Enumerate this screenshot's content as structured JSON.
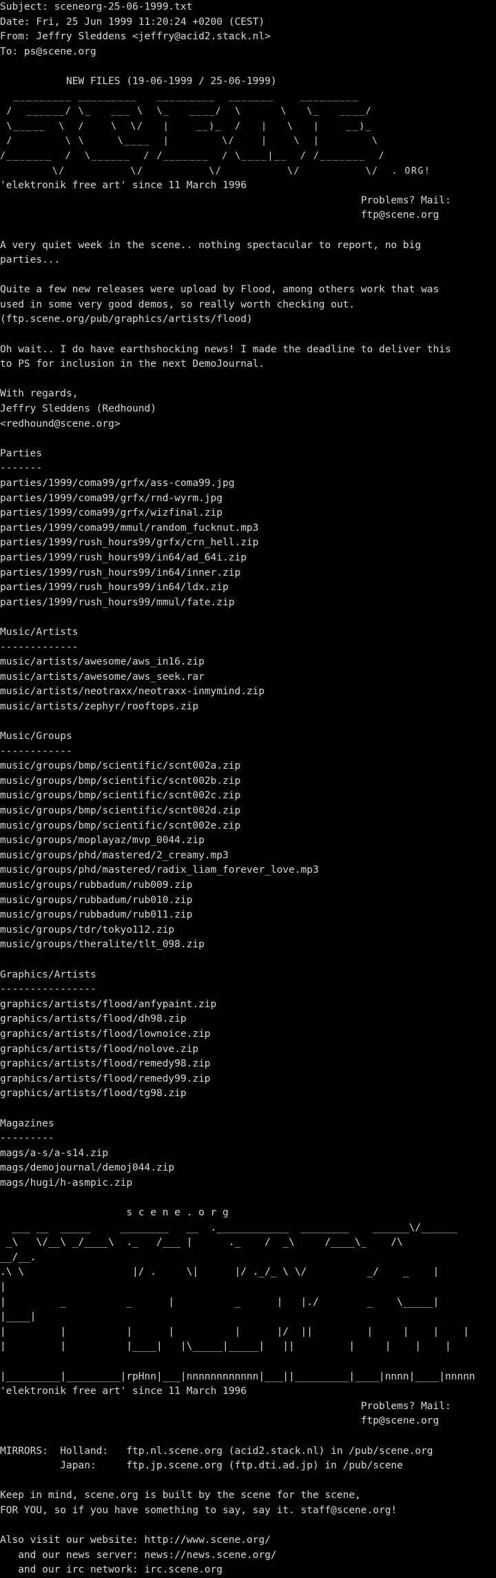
{
  "header": {
    "subject": "Subject: sceneorg-25-06-1999.txt",
    "date": "Date: Fri, 25 Jun 1999 11:20:24 +0200 (CEST)",
    "from": "From: Jeffry Sleddens <jeffry@acid2.stack.nl>",
    "to": "To: ps@scene.org"
  },
  "title": "           NEW FILES (19-06-1999 / 25-06-1999)",
  "logo1": [
    "  _________ _________   _________  _______    _________",
    " /  ______/ \\_   ___ \\  \\_   ____/  \\      \\   \\_   ____/",
    " \\_____  \\  /    \\  \\/   |    __)_  /   |   \\   |    __)_",
    " /        \\ \\     \\____  |        \\/    |    \\  |        \\",
    "/_______  /  \\______  / /_______  / \\____|__  / /_______  /",
    "        \\/          \\/          \\/          \\/          \\/  . ORG!"
  ],
  "tagline": "'elektronik free art' since 11 March 1996",
  "problems": {
    "label": "                                                            Problems? Mail:",
    "email": "                                                            ftp@scene.org"
  },
  "intro": [
    "A very quiet week in the scene.. nothing spectacular to report, no big",
    "parties...",
    "",
    "Quite a few new releases were upload by Flood, among others work that was",
    "used in some very good demos, so really worth checking out.",
    "(ftp.scene.org/pub/graphics/artists/flood)",
    "",
    "Oh wait.. I do have earthshocking news! I made the deadline to deliver this",
    "to PS for inclusion in the next DemoJournal.",
    "",
    "With regards,",
    "Jeffry Sleddens (Redhound)",
    "<redhound@scene.org>"
  ],
  "sections": [
    {
      "title": "Parties",
      "underline": "-------",
      "files": [
        "parties/1999/coma99/grfx/ass-coma99.jpg",
        "parties/1999/coma99/grfx/rnd-wyrm.jpg",
        "parties/1999/coma99/grfx/wizfinal.zip",
        "parties/1999/coma99/mmul/random_fucknut.mp3",
        "parties/1999/rush_hours99/grfx/crn_hell.zip",
        "parties/1999/rush_hours99/in64/ad_64i.zip",
        "parties/1999/rush_hours99/in64/inner.zip",
        "parties/1999/rush_hours99/in64/ldx.zip",
        "parties/1999/rush_hours99/mmul/fate.zip"
      ]
    },
    {
      "title": "Music/Artists",
      "underline": "-------------",
      "files": [
        "music/artists/awesome/aws_in16.zip",
        "music/artists/awesome/aws_seek.rar",
        "music/artists/neotraxx/neotraxx-inmymind.zip",
        "music/artists/zephyr/rooftops.zip"
      ]
    },
    {
      "title": "Music/Groups",
      "underline": "------------",
      "files": [
        "music/groups/bmp/scientific/scnt002a.zip",
        "music/groups/bmp/scientific/scnt002b.zip",
        "music/groups/bmp/scientific/scnt002c.zip",
        "music/groups/bmp/scientific/scnt002d.zip",
        "music/groups/bmp/scientific/scnt002e.zip",
        "music/groups/moplayaz/mvp_0044.zip",
        "music/groups/phd/mastered/2_creamy.mp3",
        "music/groups/phd/mastered/radix_liam_forever_love.mp3",
        "music/groups/rubbadum/rub009.zip",
        "music/groups/rubbadum/rub010.zip",
        "music/groups/rubbadum/rub011.zip",
        "music/groups/tdr/tokyo112.zip",
        "music/groups/theralite/tlt_098.zip"
      ]
    },
    {
      "title": "Graphics/Artists",
      "underline": "----------------",
      "files": [
        "graphics/artists/flood/anfypaint.zip",
        "graphics/artists/flood/dh98.zip",
        "graphics/artists/flood/lownoice.zip",
        "graphics/artists/flood/nolove.zip",
        "graphics/artists/flood/remedy98.zip",
        "graphics/artists/flood/remedy99.zip",
        "graphics/artists/flood/tg98.zip"
      ]
    },
    {
      "title": "Magazines",
      "underline": "---------",
      "files": [
        "mags/a-s/a-s14.zip",
        "mags/demojournal/demoj044.zip",
        "mags/hugi/h-asmpic.zip"
      ]
    }
  ],
  "footer": {
    "logo_title": "                     s c e n e . o r g",
    "logo2": [
      "  ___ __  _____     ________   __  .____________  ________    ______\\/______",
      " _\\   \\/__\\ _/____\\  ._   /___ |      ._    /  _\\     /____\\_    /\\",
      "__/__.",
      ".\\ \\                  |/ .     \\|      |/ ._/_ \\ \\/          _/    _    |",
      "|",
      "|         _          _      |          _      |   |./        _    \\_____|",
      "|____|",
      "|         |          |      |          |      |/  ||         |     |    |    |",
      "|         |          |____|   |\\_____|_____|   ||         |     |    |    |",
      "",
      "|_________|_________|rpHnn|___|nnnnnnnnnnnn|___||_________|____|nnnn|____|nnnnn"
    ],
    "tagline": "'elektronik free art' since 11 March 1996",
    "problems_label": "                                                            Problems? Mail:",
    "problems_email": "                                                            ftp@scene.org",
    "mirrors": [
      "MIRRORS:  Holland:   ftp.nl.scene.org (acid2.stack.nl) in /pub/scene.org",
      "          Japan:     ftp.jp.scene.org (ftp.dti.ad.jp) in /pub/scene"
    ],
    "closing": [
      "Keep in mind, scene.org is built by the scene for the scene,",
      "FOR YOU, so if you have something to say, say it. staff@scene.org!"
    ],
    "website": "Also visit our website: http://www.scene.org/",
    "news": "   and our news server: news://news.scene.org/",
    "irc": "   and our irc network: irc.scene.org"
  }
}
